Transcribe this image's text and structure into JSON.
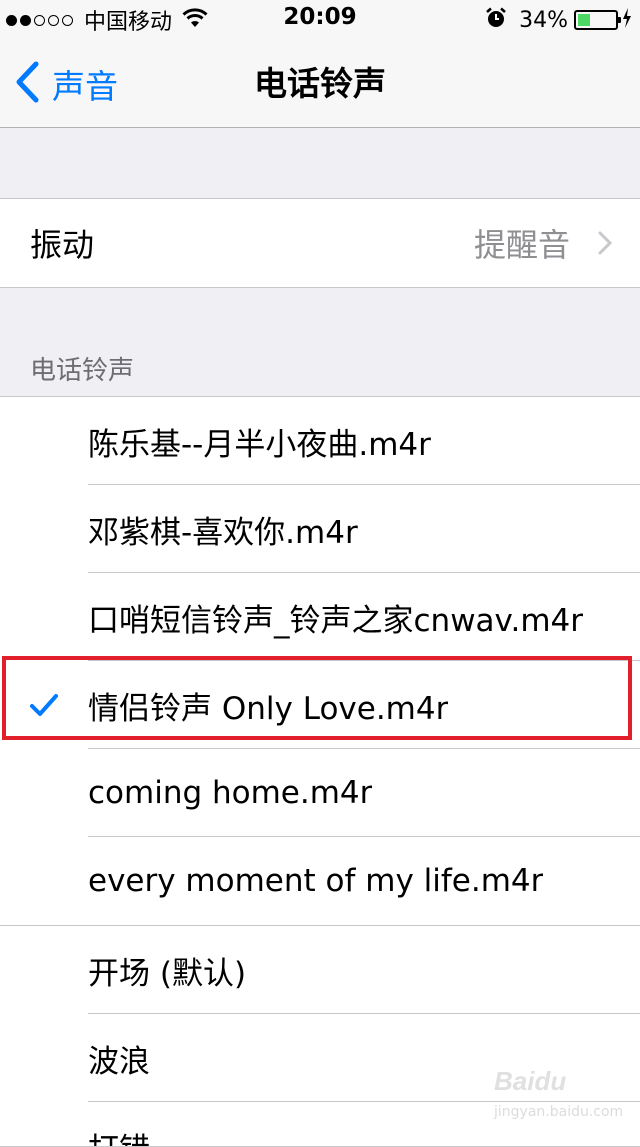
{
  "status_bar": {
    "carrier": "中国移动",
    "time": "20:09",
    "battery_percent": "34%",
    "battery_level": 0.34,
    "signal_bars_filled": 2,
    "signal_bars_total": 5,
    "icons": [
      "wifi-icon",
      "alarm-icon",
      "battery-icon",
      "charging-bolt-icon"
    ]
  },
  "nav": {
    "back_label": "声音",
    "title": "电话铃声"
  },
  "vibration": {
    "label": "振动",
    "value": "提醒音"
  },
  "section_header": "电话铃声",
  "custom_ringtones": [
    {
      "label": "陈乐基--月半小夜曲.m4r",
      "selected": false
    },
    {
      "label": "邓紫棋-喜欢你.m4r",
      "selected": false
    },
    {
      "label": "口哨短信铃声_铃声之家cnwav.m4r",
      "selected": false
    },
    {
      "label": "情侣铃声 Only Love.m4r",
      "selected": true
    },
    {
      "label": "coming home.m4r",
      "selected": false
    },
    {
      "label": "every moment of my life.m4r",
      "selected": false
    }
  ],
  "builtin_ringtones": [
    {
      "label": "开场 (默认)",
      "selected": false
    },
    {
      "label": "波浪",
      "selected": false
    },
    {
      "label": "打错",
      "selected": false
    }
  ],
  "colors": {
    "accent": "#007aff",
    "highlight_box": "#e2202c",
    "battery_fill": "#4cd964",
    "background": "#efeff4"
  },
  "watermark": {
    "brand": "Baidu",
    "subtitle": "jingyan.baidu.com"
  }
}
